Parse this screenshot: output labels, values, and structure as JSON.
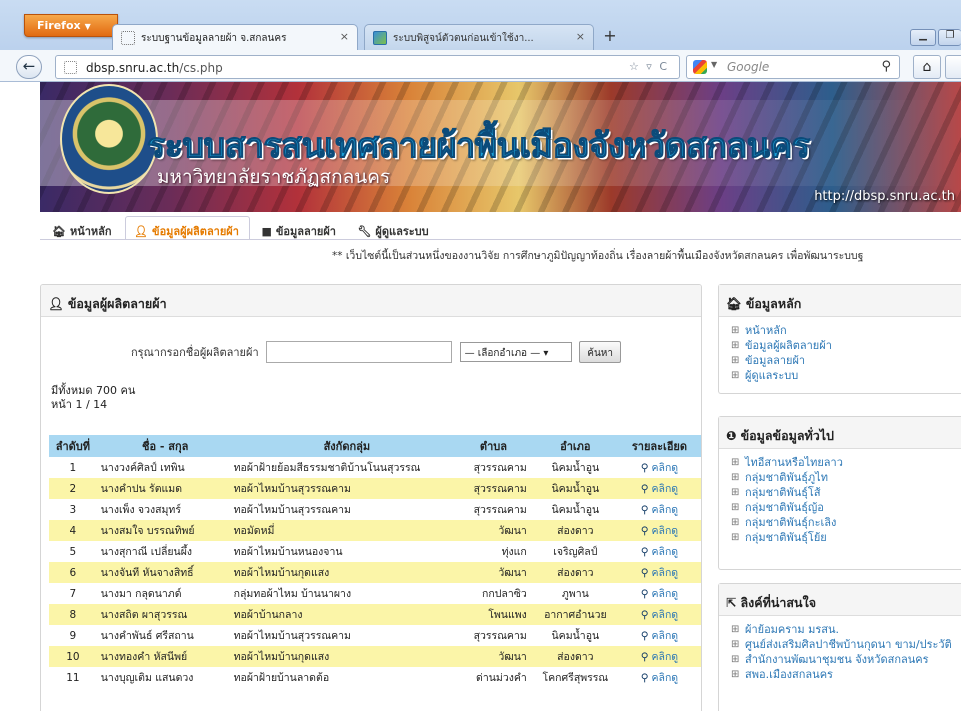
{
  "browser": {
    "menu_label": "Firefox",
    "tabs": [
      {
        "title": "ระบบฐานข้อมูลลายผ้า จ.สกลนคร",
        "close": "×"
      },
      {
        "title": "ระบบพิสูจน์ตัวตนก่อนเข้าใช้งา...",
        "close": "×"
      }
    ],
    "new_tab": "+",
    "url_host": "dbsp.snru.ac.th",
    "url_path": "/cs.php",
    "url_tools": "☆ ▿ C",
    "search_engine": "Google",
    "home_icon": "⌂"
  },
  "site": {
    "title": "ระบบสารสนเทศลายผ้าพื้นเมืองจังหวัดสกลนคร",
    "subtitle": "มหาวิทยาลัยราชภัฏสกลนคร",
    "url": "http://dbsp.snru.ac.th"
  },
  "menu": [
    {
      "label": "หน้าหลัก",
      "icon": "home-icon"
    },
    {
      "label": "ข้อมูลผู้ผลิตลายผ้า",
      "icon": "user-icon"
    },
    {
      "label": "ข้อมูลลายผ้า",
      "icon": "book-icon"
    },
    {
      "label": "ผู้ดูแลระบบ",
      "icon": "wrench-icon"
    }
  ],
  "notice": "** เว็บไซต์นี้เป็นส่วนหนึ่งของงานวิจัย การศึกษาภูมิปัญญาท้องถิ่น เรื่องลายผ้าพื้นเมืองจังหวัดสกลนคร เพื่อพัฒนาระบบฐ",
  "main": {
    "heading": "ข้อมูลผู้ผลิตลายผ้า",
    "search_label": "กรุณากรอกชื่อผู้ผลิตลายผ้า",
    "search_value": "",
    "district_select": "— เลือกอำเภอ —",
    "search_button": "ค้นหา",
    "total": "มีทั้งหมด 700 คน",
    "page": "หน้า 1 / 14",
    "columns": [
      "ลำดับที่",
      "ชื่อ - สกุล",
      "สังกัดกลุ่ม",
      "ตำบล",
      "อำเภอ",
      "รายละเอียด"
    ],
    "detail_label": "คลิกดู",
    "rows": [
      {
        "no": "1",
        "name": "นางวงค์ศิลป์ เทพิน",
        "group": "ทอผ้าฝ้ายย้อมสีธรรมชาติบ้านโนนสุวรรณ",
        "tambon": "สุวรรณคาม",
        "amphoe": "นิคมน้ำอูน"
      },
      {
        "no": "2",
        "name": "นางคำปน รัตแมด",
        "group": "ทอผ้าไหมบ้านสุวรรณคาม",
        "tambon": "สุวรรณคาม",
        "amphoe": "นิคมน้ำอูน"
      },
      {
        "no": "3",
        "name": "นางเพ็ง จวงสมุทร์",
        "group": "ทอผ้าไหมบ้านสุวรรณคาม",
        "tambon": "สุวรรณคาม",
        "amphoe": "นิคมน้ำอูน"
      },
      {
        "no": "4",
        "name": "นางสมใจ บรรณทิพย์",
        "group": "ทอมัดหมี่",
        "tambon": "วัฒนา",
        "amphoe": "ส่องดาว"
      },
      {
        "no": "5",
        "name": "นางสุกาณี เปลี่ยนผึ้ง",
        "group": "ทอผ้าไหมบ้านหนองจาน",
        "tambon": "ทุ่งแก",
        "amphoe": "เจริญศิลป์"
      },
      {
        "no": "6",
        "name": "นางจันที หันจางสิทธิ์",
        "group": "ทอผ้าไหมบ้านกุดแสง",
        "tambon": "วัฒนา",
        "amphoe": "ส่องดาว"
      },
      {
        "no": "7",
        "name": "นางมา กลุดนาภด์",
        "group": "กลุ่มทอผ้าไหม บ้านนาผาง",
        "tambon": "กกปลาซิว",
        "amphoe": "ภูพาน"
      },
      {
        "no": "8",
        "name": "นางสถิต ผาสุวรรณ",
        "group": "ทอผ้าบ้านกลาง",
        "tambon": "โพนแพง",
        "amphoe": "อากาศอำนวย"
      },
      {
        "no": "9",
        "name": "นางคำพันธ์ ศรีสถาน",
        "group": "ทอผ้าไหมบ้านสุวรรณคาม",
        "tambon": "สุวรรณคาม",
        "amphoe": "นิคมน้ำอูน"
      },
      {
        "no": "10",
        "name": "นางทองคำ หัสนีพย์",
        "group": "ทอผ้าไหมบ้านกุดแสง",
        "tambon": "วัฒนา",
        "amphoe": "ส่องดาว"
      },
      {
        "no": "11",
        "name": "นางบุญเติม แสนดวง",
        "group": "ทอผ้าฝ้ายบ้านลาดต้อ",
        "tambon": "ด่านม่วงคำ",
        "amphoe": "โคกศรีสุพรรณ"
      }
    ]
  },
  "sidebar": {
    "main_info": {
      "heading": "ข้อมูลหลัก",
      "items": [
        "หน้าหลัก",
        "ข้อมูลผู้ผลิตลายผ้า",
        "ข้อมูลลายผ้า",
        "ผู้ดูแลระบบ"
      ]
    },
    "general_info": {
      "heading": "ข้อมูลข้อมูลทั่วไป",
      "items": [
        "ไทอีสานหรือไทยลาว",
        "กลุ่มชาติพันธุ์ภูไท",
        "กลุ่มชาติพันธุ์โส้",
        "กลุ่มชาติพันธุ์ญ้อ",
        "กลุ่มชาติพันธุ์กะเลิง",
        "กลุ่มชาติพันธุ์โย้ย"
      ]
    },
    "links": {
      "heading": "ลิงค์ที่น่าสนใจ",
      "items": [
        "ผ้าย้อมคราม มรสน.",
        "ศูนย์ส่งเสริมศิลปาชีพบ้านกุดนา ขาม/ประวัติ",
        "สำนักงานพัฒนาชุมชน จังหวัดสกลนคร",
        "สพอ.เมืองสกลนคร"
      ]
    }
  }
}
